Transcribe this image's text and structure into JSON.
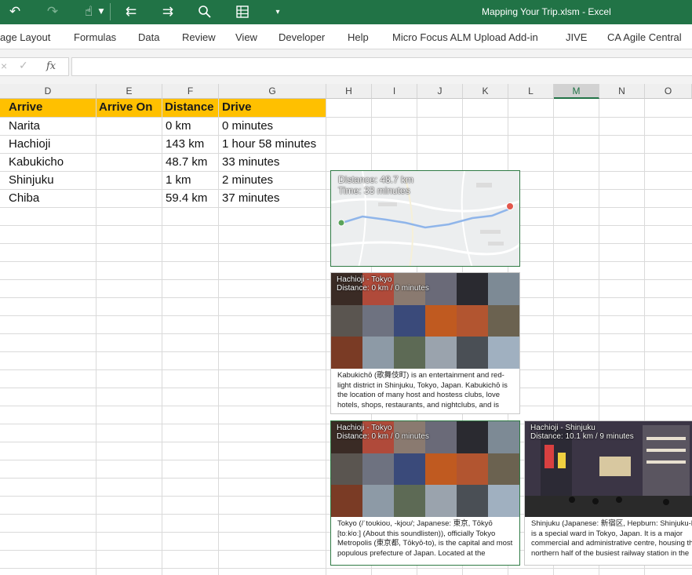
{
  "window": {
    "title": "Mapping Your Trip.xlsm  -  Excel",
    "icons": [
      "undo-icon",
      "redo-icon",
      "touch-mode-icon",
      "dropdown-icon",
      "back-icon",
      "forward-icon",
      "search-icon",
      "form-icon",
      "customize-icon"
    ]
  },
  "ribbon": {
    "tabs": [
      "age Layout",
      "Formulas",
      "Data",
      "Review",
      "View",
      "Developer",
      "Help",
      "Micro Focus ALM Upload Add-in",
      "JIVE",
      "CA Agile Central"
    ]
  },
  "formula_bar": {
    "cancel_glyph": "×",
    "enter_glyph": "✓",
    "fx_label": "fx",
    "value": ""
  },
  "columns": [
    "D",
    "E",
    "F",
    "G",
    "H",
    "I",
    "J",
    "K",
    "L",
    "M",
    "N",
    "O"
  ],
  "active_column": "M",
  "table": {
    "headers": {
      "arrive": "Arrive",
      "arrive_on": "Arrive On",
      "distance": "Distance",
      "drive": "Drive"
    },
    "rows": [
      {
        "arrive": "Narita",
        "arrive_on": "",
        "distance": "0 km",
        "drive": "0 minutes"
      },
      {
        "arrive": "Hachioji",
        "arrive_on": "",
        "distance": "143 km",
        "drive": "1 hour 58 minutes"
      },
      {
        "arrive": "Kabukicho",
        "arrive_on": "",
        "distance": "48.7 km",
        "drive": "33 minutes"
      },
      {
        "arrive": "Shinjuku",
        "arrive_on": "",
        "distance": "1 km",
        "drive": "2 minutes"
      },
      {
        "arrive": "Chiba",
        "arrive_on": "",
        "distance": "59.4 km",
        "drive": "37 minutes"
      }
    ]
  },
  "map_card": {
    "distance": "Distance: 48.7 km",
    "time": "Time: 33 minutes"
  },
  "card1": {
    "title": "Hachioji - Tokyo",
    "distance": "Distance: 0 km / 0 minutes",
    "description": "Kabukichō (歌舞伎町) is an entertainment and red-light district in Shinjuku, Tokyo, Japan. Kabukichō is the location of many host and hostess clubs, love hotels, shops, restaurants, and nightclubs, and is"
  },
  "card2": {
    "title": "Hachioji - Tokyo",
    "distance": "Distance: 0 km / 0 minutes",
    "description": "Tokyo (/ˈtoʊkioʊ, -kjoʊ/; Japanese: 東京, Tōkyō [toːkʲoː] (About this soundlisten)), officially Tokyo Metropolis (東京都, Tōkyō-to), is the capital and most populous prefecture of Japan. Located at the"
  },
  "card3": {
    "title": "Hachioji - Shinjuku",
    "distance": "Distance: 10.1 km / 9 minutes",
    "description": "Shinjuku (Japanese: 新宿区, Hepburn: Shinjuku-ku) is a special ward in Tokyo, Japan. It is a major commercial and administrative centre, housing the northern half of the busiest railway station in the"
  },
  "colors": {
    "excel_green": "#217346",
    "header_fill": "#ffc000",
    "selection_border": "#2f7a44"
  }
}
